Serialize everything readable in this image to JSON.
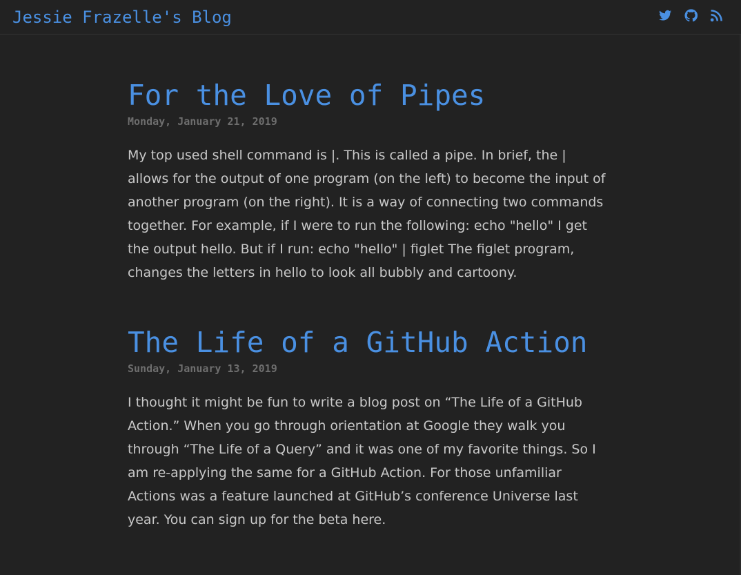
{
  "site": {
    "title": "Jessie Frazelle's Blog",
    "icons": [
      "twitter-icon",
      "github-icon",
      "rss-icon"
    ],
    "accent_color": "#4a90e2",
    "background_color": "#222222"
  },
  "posts": [
    {
      "title": "For the Love of Pipes",
      "date": "Monday, January 21, 2019",
      "excerpt": "My top used shell command is |. This is called a pipe. In brief, the | allows for the output of one program (on the left) to become the input of another program (on the right). It is a way of connecting two commands together. For example, if I were to run the following: echo \"hello\" I get the output hello. But if I run: echo \"hello\" | figlet The figlet program, changes the letters in hello to look all bubbly and cartoony."
    },
    {
      "title": "The Life of a GitHub Action",
      "date": "Sunday, January 13, 2019",
      "excerpt": "I thought it might be fun to write a blog post on “The Life of a GitHub Action.” When you go through orientation at Google they walk you through “The Life of a Query” and it was one of my favorite things. So I am re-applying the same for a GitHub Action. For those unfamiliar Actions was a feature launched at GitHub’s conference Universe last year. You can sign up for the beta here."
    }
  ]
}
